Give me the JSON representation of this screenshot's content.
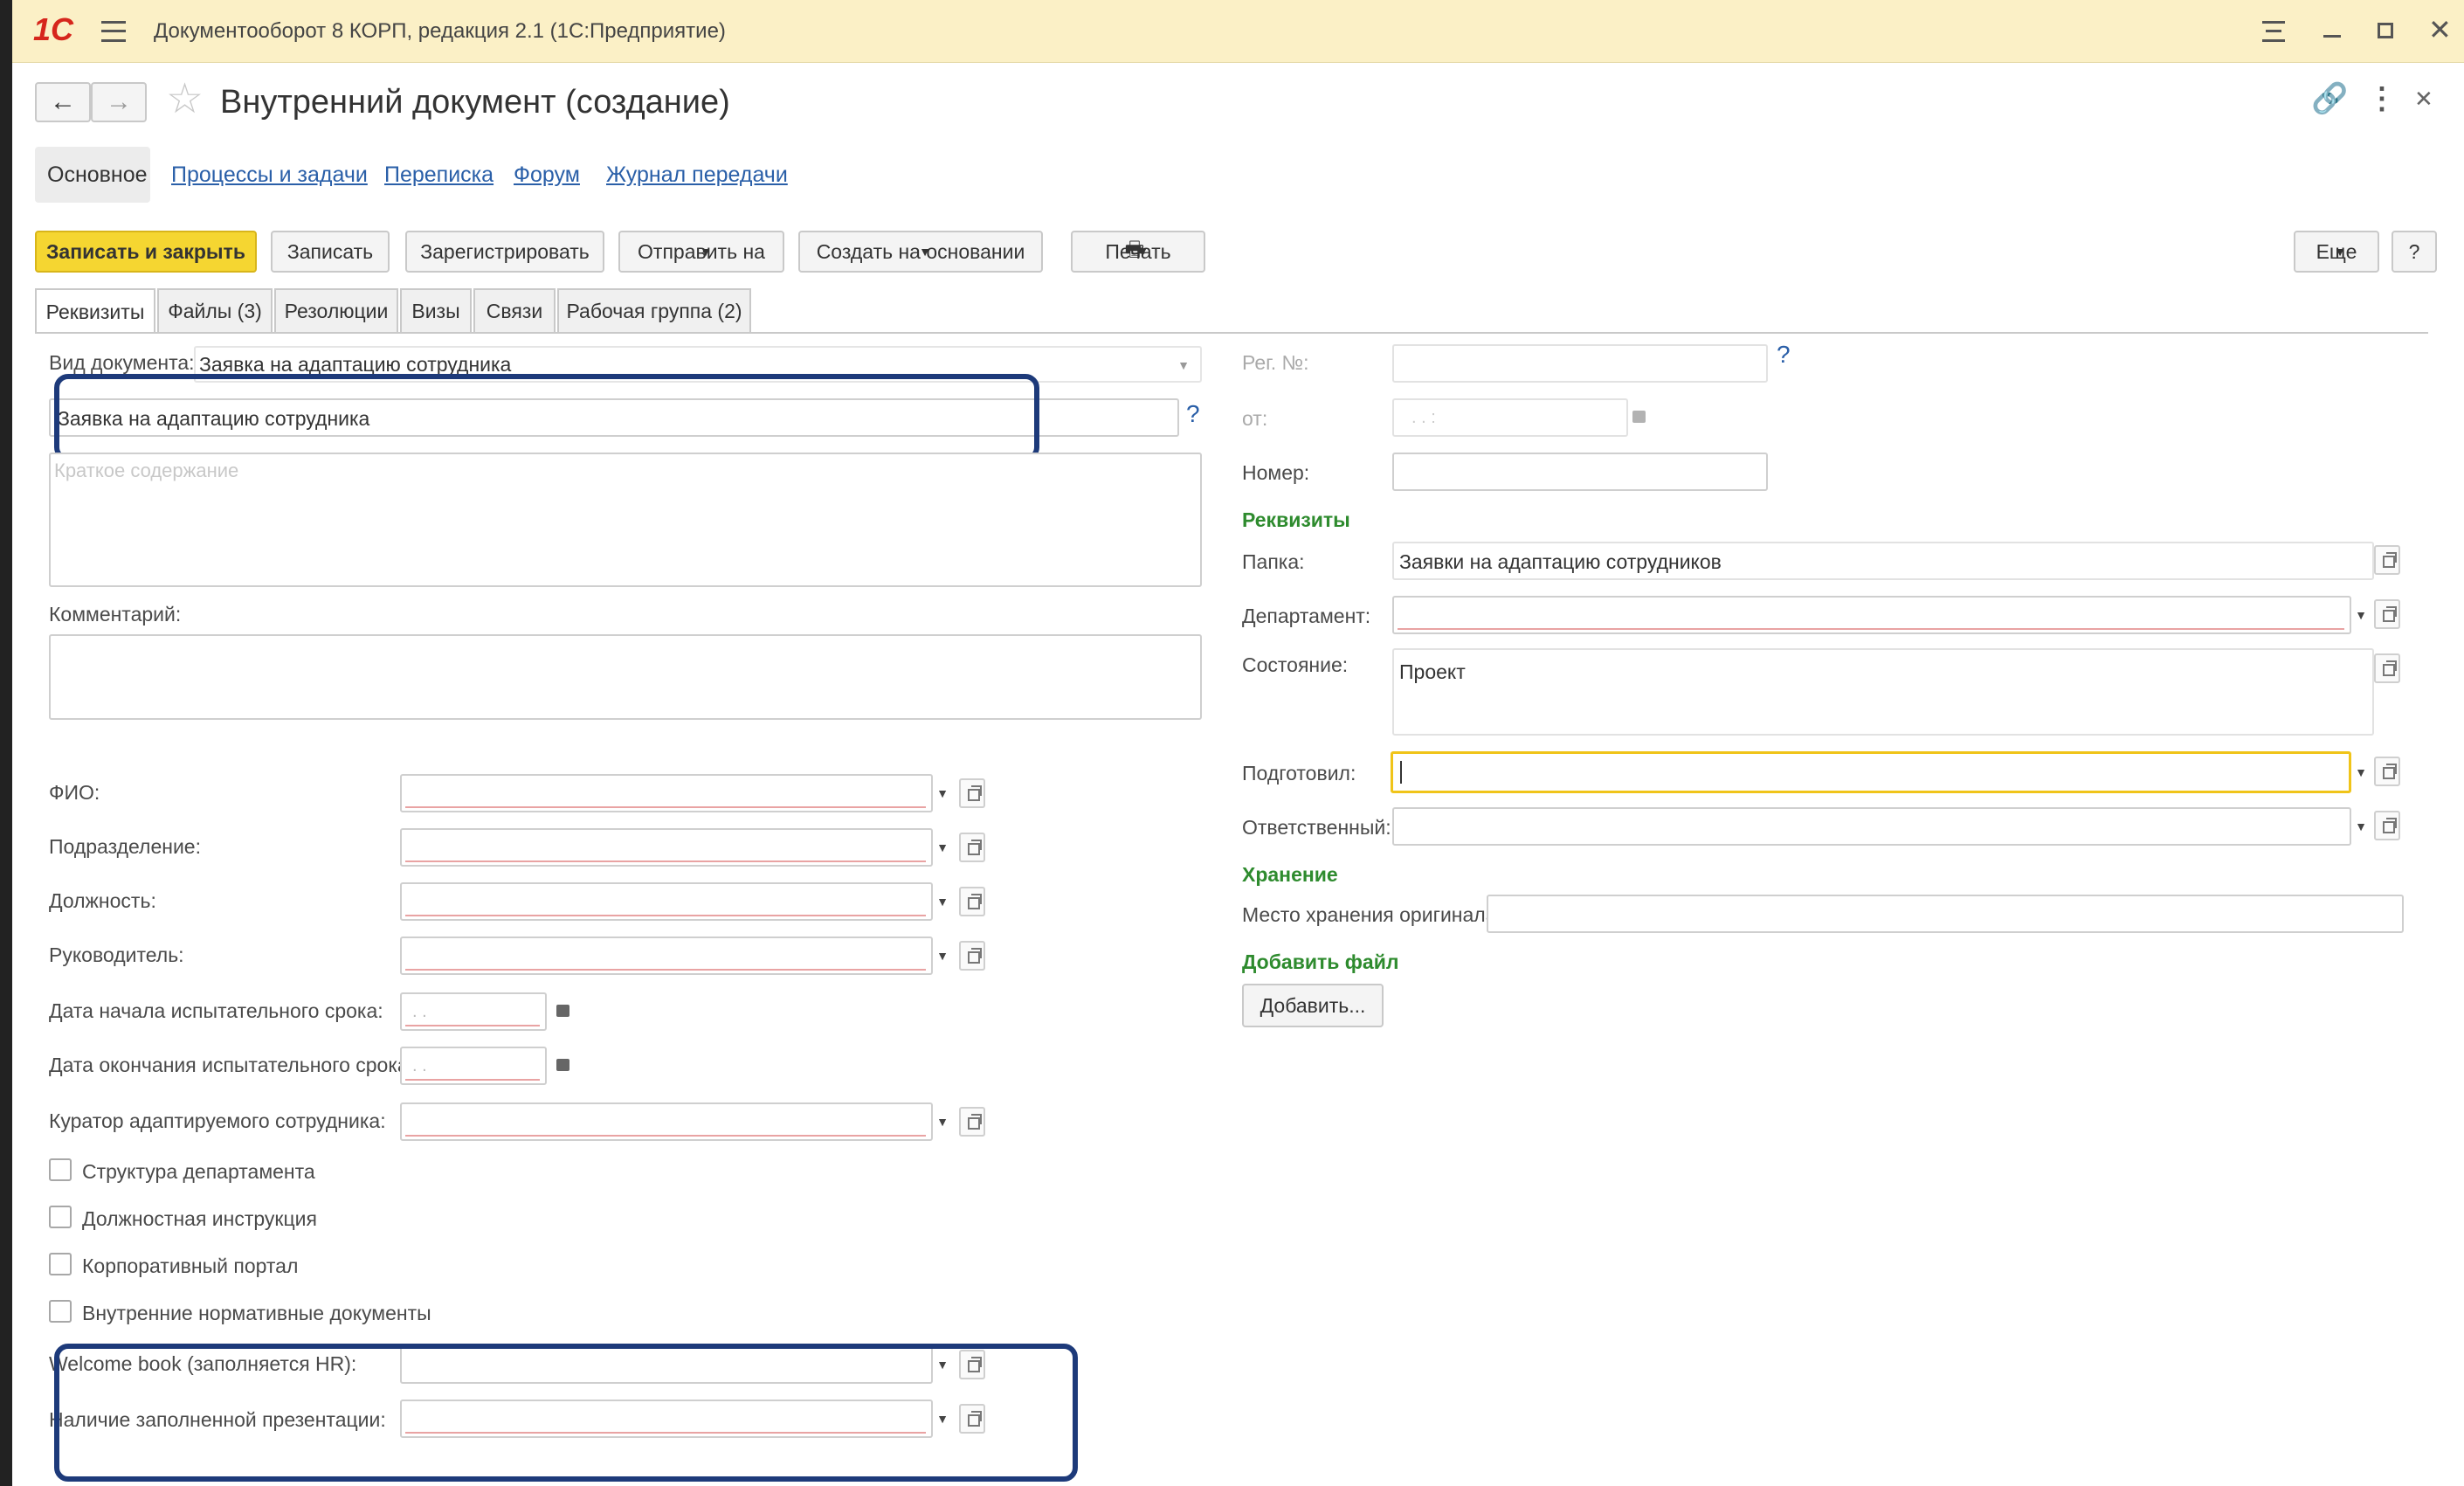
{
  "window": {
    "title": "Документооборот 8 КОРП, редакция 2.1  (1С:Предприятие)",
    "logo": "1С"
  },
  "form": {
    "title": "Внутренний документ (создание)"
  },
  "nav_tabs": [
    "Основное",
    "Процессы и задачи",
    "Переписка",
    "Форум",
    "Журнал передачи"
  ],
  "toolbar": {
    "save_close": "Записать и закрыть",
    "save": "Записать",
    "register": "Зарегистрировать",
    "send": "Отправить на",
    "create_basis": "Создать на основании",
    "print": "Печать",
    "more": "Еще",
    "help": "?"
  },
  "tabs": [
    "Реквизиты",
    "Файлы (3)",
    "Резолюции",
    "Визы",
    "Связи",
    "Рабочая группа (2)"
  ],
  "left": {
    "doc_type_label": "Вид документа:",
    "doc_type_value": "Заявка на адаптацию сотрудника",
    "title_value": "Заявка на адаптацию сотрудника",
    "title_help": "?",
    "summary_placeholder": "Краткое содержание",
    "comment_label": "Комментарий:",
    "fio": "ФИО:",
    "division": "Подразделение:",
    "position": "Должность:",
    "manager": "Руководитель:",
    "trial_start": "Дата начала испытательного срока:",
    "trial_end": "Дата окончания испытательного срока:",
    "date_placeholder": ". .",
    "curator": "Куратор адаптируемого сотрудника:",
    "chk1": "Структура департамента",
    "chk2": "Должностная инструкция",
    "chk3": "Корпоративный портал",
    "chk4": "Внутренние нормативные документы",
    "welcome": "Welcome book (заполняется HR):",
    "presentation": "Наличие заполненной презентации:"
  },
  "right": {
    "reg_no": "Рег. №:",
    "reg_help": "?",
    "from": "от:",
    "from_placeholder": ". .   :",
    "number": "Номер:",
    "sec_req": "Реквизиты",
    "folder": "Папка:",
    "folder_value": "Заявки на адаптацию сотрудников",
    "department": "Департамент:",
    "state": "Состояние:",
    "state_value": "Проект",
    "prepared": "Подготовил:",
    "responsible": "Ответственный:",
    "sec_storage": "Хранение",
    "storage_place": "Место хранения оригинала:",
    "sec_add": "Добавить файл",
    "add_btn": "Добавить..."
  },
  "colors": {
    "titlebar": "#fbf0c6",
    "primary_button": "#f5d631",
    "section": "#2e8b2e",
    "link": "#2a5fa8",
    "highlight": "#1d3a7a",
    "focus": "#f0c419"
  },
  "icons": [
    "menu-icon",
    "back-arrow-icon",
    "forward-arrow-icon",
    "star-icon",
    "link-icon",
    "more-vertical-icon",
    "close-icon",
    "printer-icon",
    "calendar-icon",
    "copy-icon",
    "chevron-down-icon",
    "minimize-icon",
    "maximize-icon"
  ]
}
